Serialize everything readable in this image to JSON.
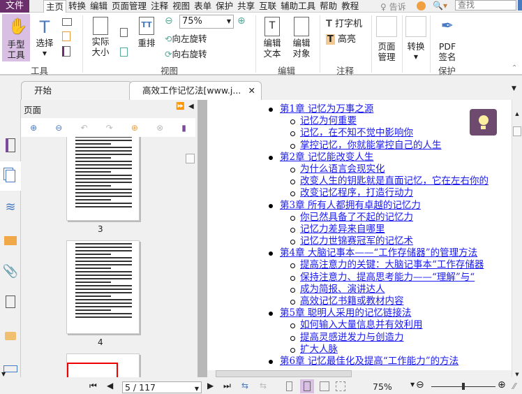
{
  "menu": {
    "file": "文件",
    "items": [
      "主页",
      "转换",
      "编辑",
      "页面管理",
      "注释",
      "视图",
      "表单",
      "保护",
      "共享",
      "互联",
      "辅助工具",
      "帮助",
      "教程"
    ],
    "tell": "告诉",
    "search_placeholder": "查找"
  },
  "ribbon": {
    "hand": "手型\n工具",
    "select": "选择",
    "actual_size": "实际\n大小",
    "reflow": "重排",
    "zoom_value": "75%",
    "rotate_left": "向左旋转",
    "rotate_right": "向右旋转",
    "edit_text": "编辑\n文本",
    "edit_object": "编辑\n对象",
    "typewriter": "打字机",
    "highlight": "高亮",
    "page_manage": "页面\n管理",
    "convert": "转换",
    "pdf_sign": "PDF\n签名",
    "groups": {
      "tools": "工具",
      "view": "视图",
      "edit": "编辑",
      "comment": "注释",
      "protect": "保护"
    }
  },
  "tabs": [
    {
      "label": "开始"
    },
    {
      "label": "高效工作记忆法[www.j..."
    }
  ],
  "panel": {
    "title": "页面",
    "pages": [
      "3",
      "4"
    ]
  },
  "toc": [
    {
      "t": "c",
      "text": "第1章  记忆为万事之源"
    },
    {
      "t": "s",
      "text": "记忆为何重要"
    },
    {
      "t": "s",
      "text": "记忆，在不知不觉中影响你"
    },
    {
      "t": "s",
      "text": "掌控记忆，你就能掌控自己的人生"
    },
    {
      "t": "c",
      "text": "第2章  记忆能改变人生"
    },
    {
      "t": "s",
      "text": "为什么语言会现实化"
    },
    {
      "t": "s",
      "text": "改变人生的钥匙就是直面记忆，它在左右你的"
    },
    {
      "t": "s",
      "text": "改变记忆程序，打造行动力"
    },
    {
      "t": "c",
      "text": "第3章  所有人都拥有卓越的记忆力"
    },
    {
      "t": "s",
      "text": "你已然具备了不起的记忆力"
    },
    {
      "t": "s",
      "text": "记忆力差异来自哪里"
    },
    {
      "t": "s",
      "text": "记忆力世锦赛冠军的记忆术"
    },
    {
      "t": "c",
      "text": "第4章  大脑记事本——“工作存储器”的管理方法"
    },
    {
      "t": "s",
      "text": "提高注意力的关键：大脑记事本“工作存储器"
    },
    {
      "t": "s",
      "text": "保持注意力、提高思考能力——“理解”与“"
    },
    {
      "t": "s",
      "text": "成为简报、演讲达人"
    },
    {
      "t": "s",
      "text": "高效记忆书籍或教材内容"
    },
    {
      "t": "c",
      "text": "第5章  聪明人采用的记忆链接法"
    },
    {
      "t": "s",
      "text": "如何输入大量信息并有效利用"
    },
    {
      "t": "s",
      "text": "提高灵感迸发力与创造力"
    },
    {
      "t": "s",
      "text": "扩大人脉"
    },
    {
      "t": "c",
      "text": "第6章  记忆最佳化及提高“工作能力”的方法"
    }
  ],
  "status": {
    "page": "5 / 117",
    "zoom": "75%",
    "zoom_fraction": 0.5
  },
  "colors": {
    "file_menu": "#6b2f6b",
    "link": "#1a1aee",
    "active_tool": "#d9bfe3",
    "tip": "#6e4a6e"
  }
}
